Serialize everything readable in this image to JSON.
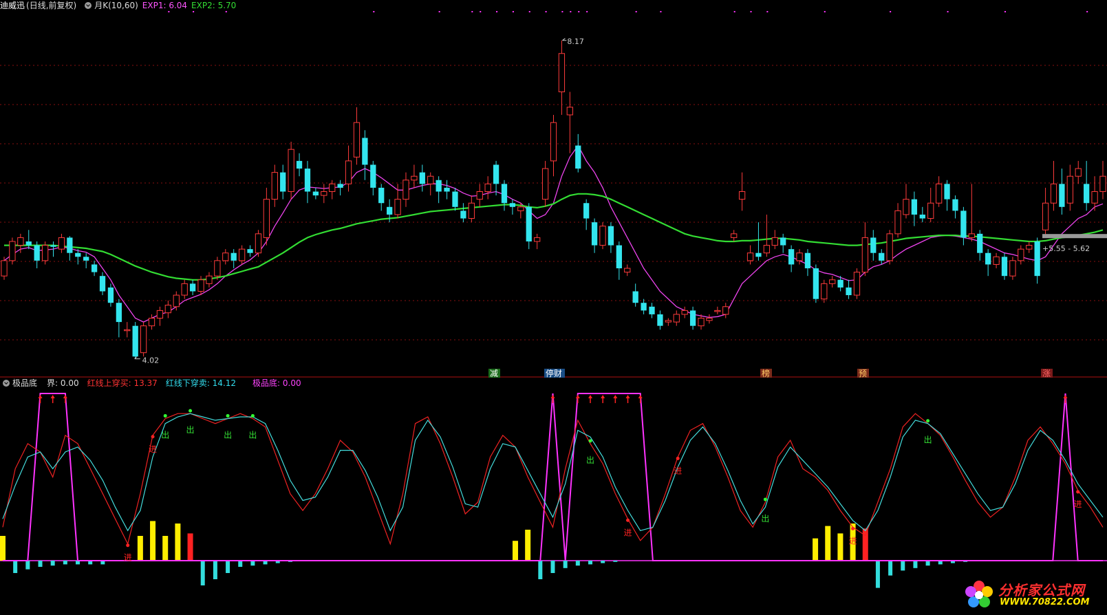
{
  "window": {
    "stock_name": "迪威迅",
    "mode": "(日线,前复权)",
    "indicator": "月K(10,60)"
  },
  "main_legend": [
    {
      "label": "EXP1: 6.04",
      "color": "#ff55ff"
    },
    {
      "label": "EXP2: 5.70",
      "color": "#33dd33"
    }
  ],
  "price_labels": {
    "high": "8.17",
    "low": "4.02",
    "range": "5.55 - 5.62"
  },
  "event_tags": [
    {
      "label": "减",
      "bg": "#1a6b1a",
      "fg": "#ffffff"
    },
    {
      "label": "停财",
      "bg": "#1a4e86",
      "fg": "#ffffff"
    },
    {
      "label": "榜",
      "bg": "#7a2a1a",
      "fg": "#ffcc66"
    },
    {
      "label": "预",
      "bg": "#7a2a1a",
      "fg": "#ffcc66"
    },
    {
      "label": "涨",
      "bg": "#7a1a1a",
      "fg": "#ff6666"
    }
  ],
  "sub_legend": {
    "name": "极品底",
    "items": [
      {
        "label": "界: 0.00",
        "color": "#dddddd"
      },
      {
        "label": "红线上穿买: 13.37",
        "color": "#ff3333"
      },
      {
        "label": "红线下穿卖: 14.12",
        "color": "#33ddee"
      },
      {
        "label": "极品底: 0.00",
        "color": "#ff44ff"
      }
    ]
  },
  "signals": {
    "sell": "出",
    "buy": "进"
  },
  "colors": {
    "up": "#ff3b3b",
    "down": "#33e5ee",
    "exp1": "#ee44ee",
    "exp2": "#33dd33",
    "grid": "#8a1010",
    "kline_red": "#ee2222",
    "kline_cyan": "#44dddd",
    "magenta": "#ff33ff",
    "yellow": "#ffee00"
  },
  "logo": {
    "text": "分析家公式网",
    "url": "WWW.70822.COM"
  },
  "chart_data": {
    "type": "candlestick",
    "panel": "main",
    "ylim": [
      3.9,
      8.5
    ],
    "candles": [
      [
        5.1,
        5.3,
        5.05,
        5.35
      ],
      [
        5.3,
        5.55,
        5.25,
        5.6
      ],
      [
        5.5,
        5.6,
        5.4,
        5.65
      ],
      [
        5.55,
        5.5,
        5.45,
        5.7
      ],
      [
        5.5,
        5.3,
        5.2,
        5.55
      ],
      [
        5.3,
        5.5,
        5.25,
        5.55
      ],
      [
        5.5,
        5.48,
        5.35,
        5.55
      ],
      [
        5.45,
        5.6,
        5.4,
        5.65
      ],
      [
        5.6,
        5.4,
        5.3,
        5.62
      ],
      [
        5.4,
        5.35,
        5.25,
        5.45
      ],
      [
        5.35,
        5.3,
        5.2,
        5.4
      ],
      [
        5.25,
        5.15,
        5.1,
        5.3
      ],
      [
        5.1,
        4.9,
        4.85,
        5.15
      ],
      [
        4.95,
        4.75,
        4.7,
        5.0
      ],
      [
        4.75,
        4.5,
        4.3,
        4.8
      ],
      [
        4.4,
        4.4,
        4.3,
        4.5
      ],
      [
        4.45,
        4.05,
        4.02,
        4.5
      ],
      [
        4.1,
        4.45,
        4.05,
        4.5
      ],
      [
        4.45,
        4.55,
        4.4,
        4.6
      ],
      [
        4.55,
        4.65,
        4.45,
        4.7
      ],
      [
        4.62,
        4.72,
        4.55,
        4.78
      ],
      [
        4.7,
        4.85,
        4.65,
        4.9
      ],
      [
        4.85,
        5.0,
        4.8,
        5.05
      ],
      [
        5.0,
        4.9,
        4.85,
        5.05
      ],
      [
        4.9,
        5.05,
        4.85,
        5.1
      ],
      [
        5.0,
        5.1,
        4.95,
        5.15
      ],
      [
        5.1,
        5.3,
        5.05,
        5.35
      ],
      [
        5.3,
        5.4,
        5.25,
        5.45
      ],
      [
        5.4,
        5.3,
        5.2,
        5.45
      ],
      [
        5.3,
        5.45,
        5.25,
        5.5
      ],
      [
        5.45,
        5.4,
        5.35,
        5.5
      ],
      [
        5.4,
        5.65,
        5.35,
        5.7
      ],
      [
        5.6,
        6.1,
        5.5,
        6.25
      ],
      [
        6.1,
        6.45,
        6.0,
        6.55
      ],
      [
        6.45,
        6.2,
        6.1,
        6.55
      ],
      [
        6.2,
        6.75,
        6.1,
        6.85
      ],
      [
        6.6,
        6.5,
        6.4,
        6.7
      ],
      [
        6.5,
        6.2,
        6.05,
        6.6
      ],
      [
        6.2,
        6.15,
        6.1,
        6.25
      ],
      [
        6.15,
        6.2,
        6.05,
        6.3
      ],
      [
        6.2,
        6.3,
        6.1,
        6.35
      ],
      [
        6.3,
        6.25,
        6.15,
        6.35
      ],
      [
        6.3,
        6.6,
        6.2,
        6.8
      ],
      [
        6.65,
        7.1,
        6.55,
        7.3
      ],
      [
        6.9,
        6.55,
        6.35,
        7.0
      ],
      [
        6.55,
        6.25,
        6.15,
        6.6
      ],
      [
        6.25,
        6.05,
        5.95,
        6.3
      ],
      [
        6.0,
        5.9,
        5.8,
        6.1
      ],
      [
        5.9,
        6.1,
        5.85,
        6.3
      ],
      [
        6.1,
        6.35,
        6.0,
        6.45
      ],
      [
        6.35,
        6.4,
        6.25,
        6.55
      ],
      [
        6.45,
        6.3,
        6.2,
        6.55
      ],
      [
        6.3,
        6.4,
        6.15,
        6.45
      ],
      [
        6.35,
        6.2,
        6.05,
        6.4
      ],
      [
        6.25,
        6.2,
        6.1,
        6.35
      ],
      [
        6.2,
        6.0,
        5.95,
        6.25
      ],
      [
        5.95,
        5.85,
        5.8,
        6.05
      ],
      [
        5.85,
        6.05,
        5.8,
        6.15
      ],
      [
        6.1,
        6.2,
        6.0,
        6.3
      ],
      [
        6.2,
        6.3,
        6.1,
        6.4
      ],
      [
        6.55,
        6.3,
        6.15,
        6.6
      ],
      [
        6.3,
        6.05,
        5.95,
        6.35
      ],
      [
        6.05,
        6.0,
        5.9,
        6.1
      ],
      [
        5.95,
        6.0,
        5.85,
        6.05
      ],
      [
        6.0,
        5.55,
        5.45,
        6.05
      ],
      [
        5.55,
        5.6,
        5.45,
        5.65
      ],
      [
        6.1,
        6.5,
        6.0,
        6.6
      ],
      [
        6.6,
        7.1,
        6.4,
        7.2
      ],
      [
        7.5,
        8.0,
        7.2,
        8.17
      ],
      [
        7.2,
        7.3,
        6.7,
        7.5
      ],
      [
        6.8,
        6.5,
        6.45,
        6.95
      ],
      [
        6.05,
        5.85,
        5.7,
        6.1
      ],
      [
        5.8,
        5.5,
        5.4,
        5.85
      ],
      [
        5.5,
        5.75,
        5.45,
        5.8
      ],
      [
        5.75,
        5.5,
        5.4,
        5.8
      ],
      [
        5.5,
        5.2,
        5.05,
        5.55
      ],
      [
        5.15,
        5.2,
        5.1,
        5.25
      ],
      [
        4.9,
        4.75,
        4.7,
        5.0
      ],
      [
        4.75,
        4.65,
        4.6,
        4.8
      ],
      [
        4.7,
        4.6,
        4.55,
        4.75
      ],
      [
        4.6,
        4.45,
        4.4,
        4.65
      ],
      [
        4.5,
        4.52,
        4.45,
        4.55
      ],
      [
        4.5,
        4.6,
        4.45,
        4.65
      ],
      [
        4.6,
        4.65,
        4.55,
        4.7
      ],
      [
        4.65,
        4.45,
        4.4,
        4.7
      ],
      [
        4.45,
        4.55,
        4.4,
        4.6
      ],
      [
        4.52,
        4.55,
        4.48,
        4.6
      ],
      [
        4.65,
        4.65,
        4.6,
        4.7
      ],
      [
        4.6,
        4.7,
        4.55,
        4.75
      ],
      [
        5.6,
        5.65,
        5.55,
        5.7
      ],
      [
        6.1,
        6.2,
        5.95,
        6.45
      ],
      [
        5.3,
        5.4,
        5.25,
        5.5
      ],
      [
        5.4,
        5.35,
        5.3,
        5.8
      ],
      [
        5.4,
        5.5,
        5.35,
        5.9
      ],
      [
        5.5,
        5.6,
        5.45,
        5.7
      ],
      [
        5.6,
        5.5,
        5.4,
        5.65
      ],
      [
        5.45,
        5.25,
        5.15,
        5.5
      ],
      [
        5.3,
        5.4,
        5.25,
        5.45
      ],
      [
        5.4,
        5.2,
        5.1,
        5.45
      ],
      [
        5.2,
        4.8,
        4.75,
        5.25
      ],
      [
        4.8,
        5.0,
        4.75,
        5.05
      ],
      [
        5.0,
        5.05,
        4.95,
        5.1
      ],
      [
        5.05,
        4.95,
        4.9,
        5.1
      ],
      [
        4.95,
        4.85,
        4.8,
        5.05
      ],
      [
        4.85,
        5.15,
        4.8,
        5.2
      ],
      [
        5.15,
        5.6,
        5.1,
        5.8
      ],
      [
        5.6,
        5.4,
        5.3,
        5.7
      ],
      [
        5.4,
        5.3,
        5.25,
        5.45
      ],
      [
        5.3,
        5.65,
        5.25,
        5.7
      ],
      [
        5.65,
        5.95,
        5.6,
        6.05
      ],
      [
        5.9,
        6.1,
        5.85,
        6.3
      ],
      [
        6.1,
        5.9,
        5.75,
        6.2
      ],
      [
        5.9,
        5.85,
        5.8,
        6.0
      ],
      [
        5.85,
        6.05,
        5.8,
        6.25
      ],
      [
        6.05,
        6.3,
        6.0,
        6.4
      ],
      [
        6.3,
        6.1,
        5.95,
        6.35
      ],
      [
        6.1,
        5.95,
        5.85,
        6.15
      ],
      [
        5.95,
        5.6,
        5.5,
        6.0
      ],
      [
        5.6,
        5.65,
        5.55,
        6.3
      ],
      [
        5.65,
        5.4,
        5.3,
        5.7
      ],
      [
        5.4,
        5.25,
        5.1,
        5.45
      ],
      [
        5.25,
        5.35,
        5.2,
        5.4
      ],
      [
        5.35,
        5.1,
        5.05,
        5.4
      ],
      [
        5.1,
        5.3,
        5.05,
        5.35
      ],
      [
        5.3,
        5.45,
        5.25,
        5.5
      ],
      [
        5.45,
        5.5,
        5.4,
        5.55
      ],
      [
        5.55,
        5.1,
        5.0,
        5.6
      ],
      [
        5.7,
        6.05,
        5.6,
        6.25
      ],
      [
        6.05,
        6.3,
        5.95,
        6.6
      ],
      [
        6.3,
        6.0,
        5.9,
        6.5
      ],
      [
        6.05,
        6.4,
        5.95,
        6.55
      ],
      [
        6.4,
        6.5,
        6.3,
        6.6
      ],
      [
        6.3,
        6.05,
        5.95,
        6.6
      ],
      [
        6.05,
        6.2,
        5.95,
        6.4
      ],
      [
        6.2,
        6.4,
        6.1,
        6.6
      ]
    ],
    "series": [
      {
        "name": "EXP1",
        "values": [
          5.3,
          5.38,
          5.45,
          5.47,
          5.43,
          5.44,
          5.45,
          5.48,
          5.46,
          5.43,
          5.41,
          5.35,
          5.2,
          5.05,
          4.85,
          4.7,
          4.55,
          4.5,
          4.55,
          4.6,
          4.63,
          4.7,
          4.78,
          4.82,
          4.86,
          4.92,
          5.0,
          5.1,
          5.18,
          5.25,
          5.31,
          5.4,
          5.55,
          5.75,
          5.92,
          6.1,
          6.22,
          6.26,
          6.25,
          6.24,
          6.25,
          6.26,
          6.32,
          6.45,
          6.5,
          6.45,
          6.38,
          6.3,
          6.22,
          6.22,
          6.25,
          6.28,
          6.3,
          6.3,
          6.28,
          6.24,
          6.18,
          6.14,
          6.15,
          6.18,
          6.2,
          6.16,
          6.1,
          6.05,
          5.95,
          5.85,
          5.9,
          6.05,
          6.4,
          6.65,
          6.8,
          6.6,
          6.45,
          6.25,
          6.0,
          5.8,
          5.6,
          5.4,
          5.2,
          5.05,
          4.9,
          4.8,
          4.7,
          4.65,
          4.6,
          4.58,
          4.56,
          4.57,
          4.6,
          4.8,
          5.0,
          5.1,
          5.2,
          5.3,
          5.35,
          5.38,
          5.35,
          5.3,
          5.25,
          5.18,
          5.14,
          5.12,
          5.08,
          5.04,
          5.05,
          5.15,
          5.22,
          5.25,
          5.3,
          5.38,
          5.45,
          5.5,
          5.55,
          5.6,
          5.62,
          5.63,
          5.62,
          5.6,
          5.58,
          5.55,
          5.5,
          5.45,
          5.4,
          5.38,
          5.35,
          5.32,
          5.3,
          5.35,
          5.5,
          5.65,
          5.75,
          5.85,
          5.9,
          6.0,
          6.04
        ]
      },
      {
        "name": "EXP2",
        "values": [
          5.5,
          5.5,
          5.5,
          5.5,
          5.5,
          5.5,
          5.5,
          5.49,
          5.48,
          5.47,
          5.46,
          5.44,
          5.42,
          5.38,
          5.33,
          5.28,
          5.23,
          5.19,
          5.15,
          5.12,
          5.09,
          5.07,
          5.06,
          5.05,
          5.05,
          5.06,
          5.08,
          5.1,
          5.13,
          5.16,
          5.19,
          5.22,
          5.28,
          5.34,
          5.4,
          5.47,
          5.54,
          5.6,
          5.64,
          5.67,
          5.7,
          5.72,
          5.75,
          5.78,
          5.8,
          5.82,
          5.84,
          5.85,
          5.86,
          5.88,
          5.9,
          5.92,
          5.94,
          5.95,
          5.96,
          5.97,
          5.98,
          5.99,
          6.0,
          6.01,
          6.02,
          6.03,
          6.03,
          6.02,
          6.0,
          5.99,
          6.01,
          6.04,
          6.1,
          6.15,
          6.17,
          6.17,
          6.16,
          6.14,
          6.1,
          6.05,
          6.0,
          5.95,
          5.9,
          5.85,
          5.8,
          5.75,
          5.7,
          5.65,
          5.62,
          5.6,
          5.58,
          5.56,
          5.55,
          5.55,
          5.56,
          5.56,
          5.57,
          5.58,
          5.59,
          5.59,
          5.58,
          5.57,
          5.55,
          5.54,
          5.53,
          5.52,
          5.51,
          5.5,
          5.5,
          5.51,
          5.52,
          5.53,
          5.55,
          5.57,
          5.59,
          5.6,
          5.61,
          5.62,
          5.63,
          5.63,
          5.63,
          5.62,
          5.62,
          5.61,
          5.6,
          5.59,
          5.58,
          5.57,
          5.56,
          5.55,
          5.55,
          5.56,
          5.58,
          5.6,
          5.61,
          5.63,
          5.65,
          5.67,
          5.7
        ]
      }
    ],
    "sub_panel": {
      "type": "oscillator",
      "ylim": [
        0,
        100
      ],
      "red_line": [
        20,
        55,
        70,
        65,
        50,
        75,
        70,
        55,
        40,
        25,
        10,
        40,
        75,
        85,
        88,
        88,
        85,
        82,
        85,
        88,
        85,
        80,
        60,
        40,
        30,
        40,
        55,
        72,
        65,
        50,
        30,
        10,
        40,
        82,
        86,
        70,
        50,
        28,
        35,
        62,
        75,
        68,
        50,
        35,
        20,
        55,
        84,
        70,
        58,
        40,
        25,
        12,
        20,
        40,
        62,
        78,
        82,
        68,
        50,
        30,
        20,
        35,
        62,
        72,
        55,
        50,
        42,
        30,
        20,
        15,
        35,
        55,
        80,
        88,
        82,
        75,
        62,
        48,
        35,
        26,
        32,
        50,
        72,
        80,
        70,
        58,
        42,
        32,
        20
      ],
      "cyan_line": [
        25,
        45,
        62,
        65,
        55,
        65,
        68,
        60,
        48,
        32,
        18,
        30,
        62,
        82,
        86,
        88,
        86,
        84,
        85,
        86,
        86,
        82,
        66,
        48,
        36,
        38,
        50,
        66,
        66,
        54,
        38,
        18,
        32,
        72,
        84,
        74,
        56,
        34,
        32,
        55,
        70,
        68,
        54,
        40,
        26,
        46,
        78,
        74,
        62,
        44,
        30,
        18,
        20,
        36,
        56,
        72,
        80,
        70,
        54,
        36,
        22,
        32,
        56,
        68,
        60,
        52,
        44,
        34,
        24,
        18,
        30,
        50,
        74,
        84,
        82,
        76,
        64,
        52,
        40,
        30,
        32,
        46,
        66,
        78,
        72,
        60,
        46,
        36,
        26
      ],
      "magenta_line": [
        0,
        0,
        0,
        100,
        100,
        100,
        0,
        0,
        0,
        0,
        0,
        0,
        0,
        0,
        0,
        0,
        0,
        0,
        0,
        0,
        0,
        0,
        0,
        0,
        0,
        0,
        0,
        0,
        0,
        0,
        0,
        0,
        0,
        0,
        0,
        0,
        0,
        0,
        0,
        0,
        0,
        0,
        0,
        0,
        100,
        0,
        100,
        100,
        100,
        100,
        100,
        100,
        0,
        0,
        0,
        0,
        0,
        0,
        0,
        0,
        0,
        0,
        0,
        0,
        0,
        0,
        0,
        0,
        0,
        0,
        0,
        0,
        0,
        0,
        0,
        0,
        0,
        0,
        0,
        0,
        0,
        0,
        0,
        0,
        0,
        100,
        0,
        0,
        0
      ],
      "histogram": [
        20,
        -10,
        -7,
        -5,
        -4,
        -3,
        -3,
        -3,
        -3,
        0,
        0,
        20,
        32,
        20,
        30,
        22,
        -20,
        -15,
        -10,
        -5,
        -4,
        -3,
        -2,
        -1,
        0,
        0,
        0,
        0,
        0,
        0,
        0,
        0,
        0,
        0,
        0,
        0,
        0,
        0,
        0,
        0,
        0,
        16,
        25,
        -15,
        -10,
        -6,
        -4,
        -3,
        -2,
        -1,
        0,
        0,
        0,
        0,
        0,
        0,
        0,
        0,
        0,
        0,
        0,
        0,
        0,
        0,
        0,
        18,
        28,
        22,
        30,
        26,
        -22,
        -12,
        -8,
        -6,
        -4,
        -3,
        -2,
        -1,
        0,
        0,
        0,
        0,
        0,
        0,
        0,
        0,
        0,
        0,
        0
      ]
    }
  }
}
